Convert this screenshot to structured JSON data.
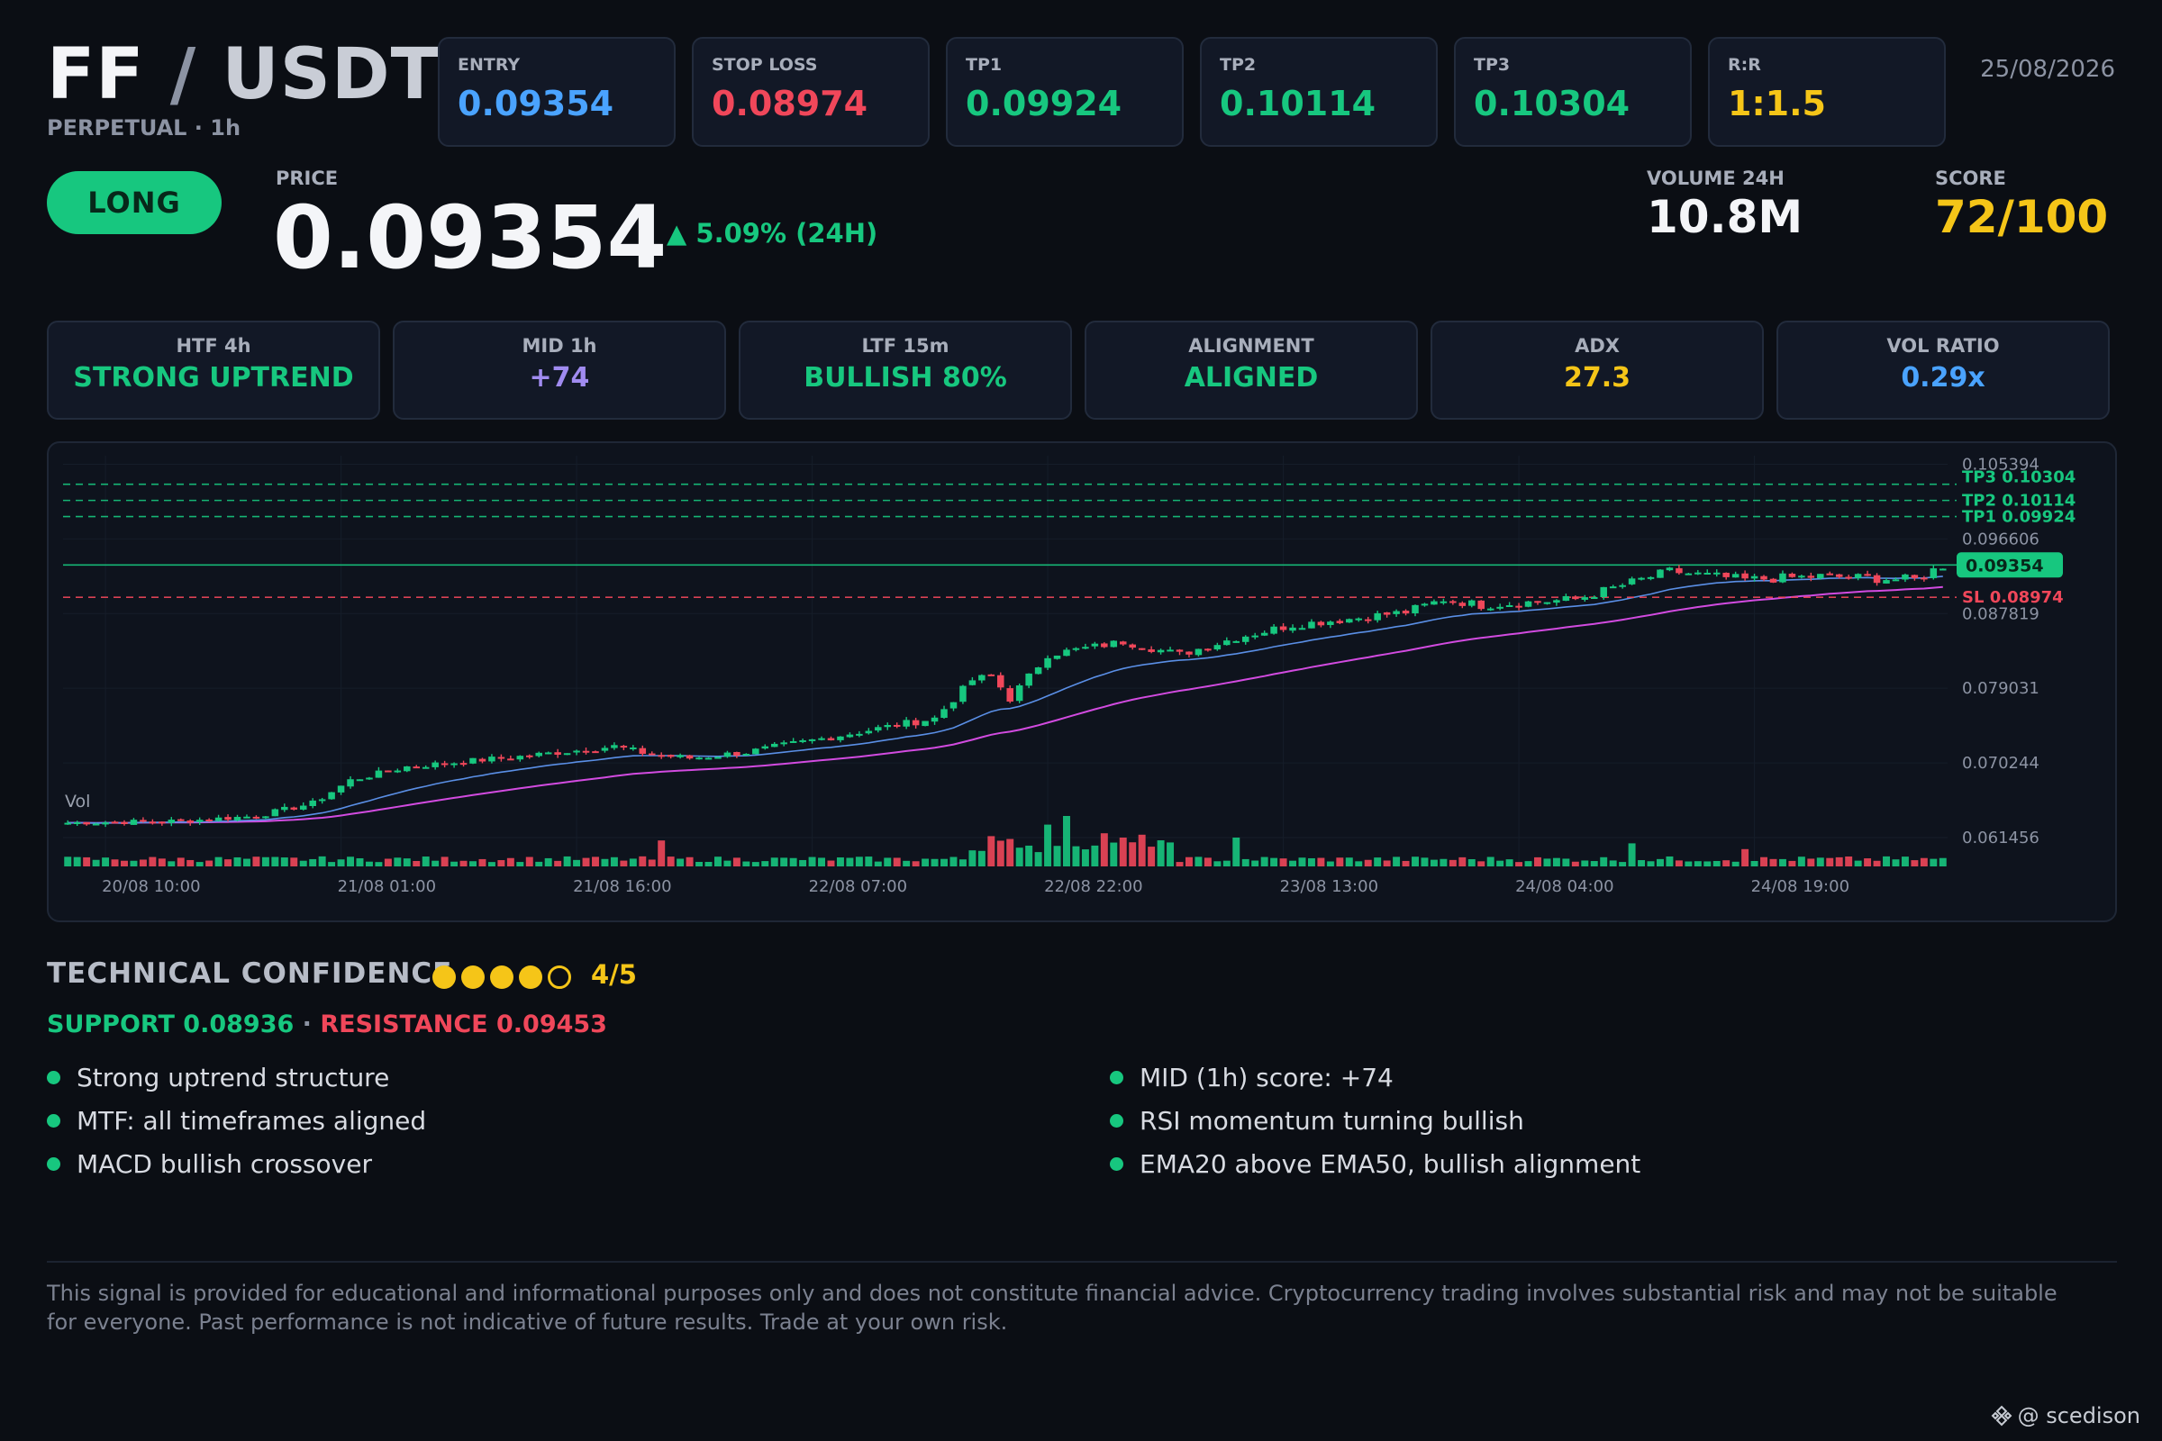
{
  "header": {
    "base": "FF",
    "separator": "/",
    "quote": "USDT",
    "subtitle": "PERPETUAL · 1h",
    "date": "25/08/2026"
  },
  "levels": [
    {
      "label": "ENTRY",
      "value": "0.09354",
      "color": "#4aa3ff"
    },
    {
      "label": "STOP LOSS",
      "value": "0.08974",
      "color": "#f0475a"
    },
    {
      "label": "TP1",
      "value": "0.09924",
      "color": "#17c77f"
    },
    {
      "label": "TP2",
      "value": "0.10114",
      "color": "#17c77f"
    },
    {
      "label": "TP3",
      "value": "0.10304",
      "color": "#17c77f"
    },
    {
      "label": "R:R",
      "value": "1:1.5",
      "color": "#f5c518"
    }
  ],
  "signal": {
    "side": "LONG",
    "price_label": "PRICE",
    "price": "0.09354",
    "change": "▲ 5.09% (24H)",
    "volume_label": "VOLUME 24H",
    "volume": "10.8M",
    "score_label": "SCORE",
    "score": "72/100"
  },
  "indicators": [
    {
      "label": "HTF 4h",
      "value": "STRONG UPTREND",
      "color": "#17c77f"
    },
    {
      "label": "MID 1h",
      "value": "+74",
      "color": "#a08bf0"
    },
    {
      "label": "LTF 15m",
      "value": "BULLISH 80%",
      "color": "#17c77f"
    },
    {
      "label": "ALIGNMENT",
      "value": "ALIGNED",
      "color": "#17c77f"
    },
    {
      "label": "ADX",
      "value": "27.3",
      "color": "#f5c518"
    },
    {
      "label": "VOL RATIO",
      "value": "0.29x",
      "color": "#4aa3ff"
    }
  ],
  "chart_data": {
    "type": "candlestick",
    "ylim": [
      0.057,
      0.1064
    ],
    "y_ticks": [
      "0.105394",
      "0.096606",
      "0.087819",
      "0.079031",
      "0.070244",
      "0.061456"
    ],
    "x_ticks": [
      "20/08 10:00",
      "21/08 01:00",
      "21/08 16:00",
      "22/08 07:00",
      "22/08 22:00",
      "23/08 13:00",
      "24/08 04:00",
      "24/08 19:00"
    ],
    "volume_label": "Vol",
    "horizontal_lines": [
      {
        "label": "TP3 0.10304",
        "value": 0.10304,
        "color": "#17c77f",
        "style": "dashed"
      },
      {
        "label": "TP2 0.10114",
        "value": 0.10114,
        "color": "#17c77f",
        "style": "dashed"
      },
      {
        "label": "TP1 0.09924",
        "value": 0.09924,
        "color": "#17c77f",
        "style": "dashed"
      },
      {
        "label": "0.09354",
        "value": 0.09354,
        "color": "#17c77f",
        "style": "solid"
      },
      {
        "label": "SL 0.08974",
        "value": 0.08974,
        "color": "#f0475a",
        "style": "dashed"
      }
    ],
    "price_tag": "0.09354",
    "close_path": [
      [
        0,
        0.0632
      ],
      [
        12,
        0.0634
      ],
      [
        20,
        0.064
      ],
      [
        26,
        0.0655
      ],
      [
        30,
        0.0682
      ],
      [
        36,
        0.0698
      ],
      [
        48,
        0.071
      ],
      [
        58,
        0.0722
      ],
      [
        62,
        0.0712
      ],
      [
        66,
        0.0708
      ],
      [
        72,
        0.0715
      ],
      [
        82,
        0.0735
      ],
      [
        92,
        0.0755
      ],
      [
        96,
        0.08
      ],
      [
        98,
        0.0805
      ],
      [
        100,
        0.0778
      ],
      [
        104,
        0.083
      ],
      [
        112,
        0.0845
      ],
      [
        118,
        0.083
      ],
      [
        124,
        0.085
      ],
      [
        130,
        0.0865
      ],
      [
        136,
        0.0872
      ],
      [
        142,
        0.088
      ],
      [
        146,
        0.0895
      ],
      [
        150,
        0.0888
      ],
      [
        160,
        0.0895
      ],
      [
        166,
        0.0915
      ],
      [
        170,
        0.0928
      ],
      [
        178,
        0.0918
      ],
      [
        186,
        0.0922
      ],
      [
        196,
        0.0918
      ],
      [
        199,
        0.0935
      ]
    ],
    "n_candles": 200,
    "volume_spikes": [
      [
        63,
        3.6
      ],
      [
        98,
        4.2
      ],
      [
        104,
        5.8
      ],
      [
        106,
        7.0
      ],
      [
        110,
        4.6
      ],
      [
        112,
        4.0
      ],
      [
        114,
        4.4
      ],
      [
        124,
        4.0
      ],
      [
        166,
        3.2
      ],
      [
        178,
        2.4
      ]
    ]
  },
  "confidence": {
    "title": "TECHNICAL CONFIDENCE",
    "filled": 4,
    "total": 5,
    "score": "4/5",
    "support": "SUPPORT 0.08936",
    "dot_sep": " · ",
    "resistance": "RESISTANCE 0.09453",
    "left_points": [
      "Strong uptrend structure",
      "MTF: all timeframes aligned",
      "MACD bullish crossover"
    ],
    "right_points": [
      "MID (1h) score: +74",
      "RSI momentum turning bullish",
      "EMA20 above EMA50, bullish alignment"
    ]
  },
  "disclaimer": "This signal is provided for educational and informational purposes only and does not constitute financial advice. Cryptocurrency trading involves substantial risk and may not be suitable for everyone. Past performance is not indicative of future results. Trade at your own risk.",
  "watermark": "@ scedison"
}
